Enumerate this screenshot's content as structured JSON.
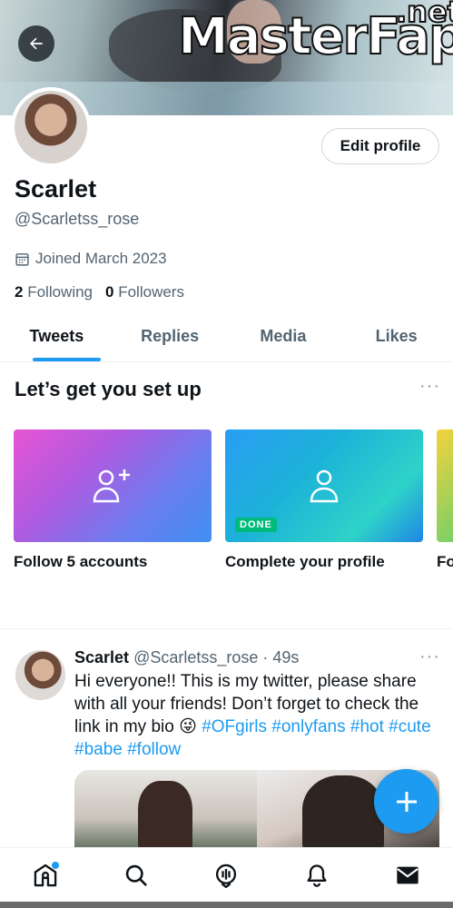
{
  "watermark": {
    "main": "MasterFap",
    "suffix": ".net"
  },
  "profile": {
    "name": "Scarlet",
    "handle": "@Scarletss_rose",
    "joined": "Joined March 2023",
    "following_count": "2",
    "following_label": "Following",
    "followers_count": "0",
    "followers_label": "Followers",
    "edit_button": "Edit profile"
  },
  "tabs": [
    {
      "label": "Tweets",
      "active": true
    },
    {
      "label": "Replies",
      "active": false
    },
    {
      "label": "Media",
      "active": false
    },
    {
      "label": "Likes",
      "active": false
    }
  ],
  "setup": {
    "title": "Let’s get you set up",
    "more": "···",
    "cards": [
      {
        "label": "Follow 5 accounts",
        "icon": "add-user-icon"
      },
      {
        "label": "Complete your profile",
        "icon": "user-icon",
        "badge": "DONE"
      },
      {
        "label": "Fo",
        "badge": ""
      }
    ]
  },
  "tweet": {
    "name": "Scarlet",
    "handle_time": "@Scarletss_rose · 49s",
    "more": "···",
    "text": "Hi everyone!! This is my twitter, please share with all your friends! Don’t forget to check the link in my bio",
    "emoji": "😜",
    "hashtags_line1": "#OFgirls #onlyfans #hot",
    "hashtags_line2": "#cute #babe #follow"
  },
  "nav": [
    "home-icon",
    "search-icon",
    "spaces-icon",
    "bell-icon",
    "mail-icon"
  ],
  "colors": {
    "accent": "#1d9bf0",
    "done": "#00ba7c",
    "muted": "#536471"
  }
}
